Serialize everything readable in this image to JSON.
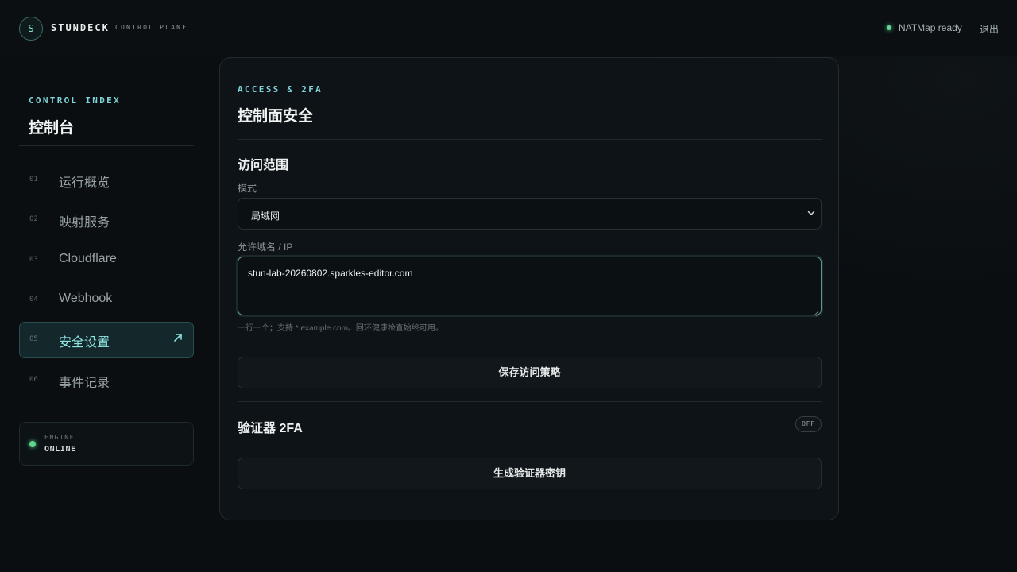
{
  "header": {
    "logo_letter": "S",
    "brand": "STUNDECK",
    "brand_sub": "CONTROL PLANE",
    "status_text": "NATMap ready",
    "status_color": "#63d69a",
    "logout_label": "退出"
  },
  "sidebar": {
    "eyebrow": "CONTROL INDEX",
    "title": "控制台",
    "items": [
      {
        "num": "01",
        "label": "运行概览",
        "active": false
      },
      {
        "num": "02",
        "label": "映射服务",
        "active": false
      },
      {
        "num": "03",
        "label": "Cloudflare",
        "active": false
      },
      {
        "num": "04",
        "label": "Webhook",
        "active": false
      },
      {
        "num": "05",
        "label": "安全设置",
        "active": true,
        "icon": "arrow-up-right-icon"
      },
      {
        "num": "06",
        "label": "事件记录",
        "active": false
      }
    ],
    "engine": {
      "label": "ENGINE",
      "value": "ONLINE",
      "color": "#5fd88f"
    }
  },
  "main": {
    "eyebrow": "ACCESS & 2FA",
    "title": "控制面安全",
    "access": {
      "section_title": "访问范围",
      "mode_label": "模式",
      "mode_value": "局域网",
      "allow_label": "允许域名 / IP",
      "allow_value": "stun-lab-20260802.sparkles-editor.com",
      "hint": "一行一个；支持 *.example.com。回环健康检查始终可用。",
      "save_button": "保存访问策略"
    },
    "twofa": {
      "section_title": "验证器 2FA",
      "toggle_label": "OFF",
      "generate_button": "生成验证器密钥"
    }
  },
  "colors": {
    "accent": "#7fd3d8",
    "background": "#0a0e11",
    "card": "#0e1317"
  }
}
